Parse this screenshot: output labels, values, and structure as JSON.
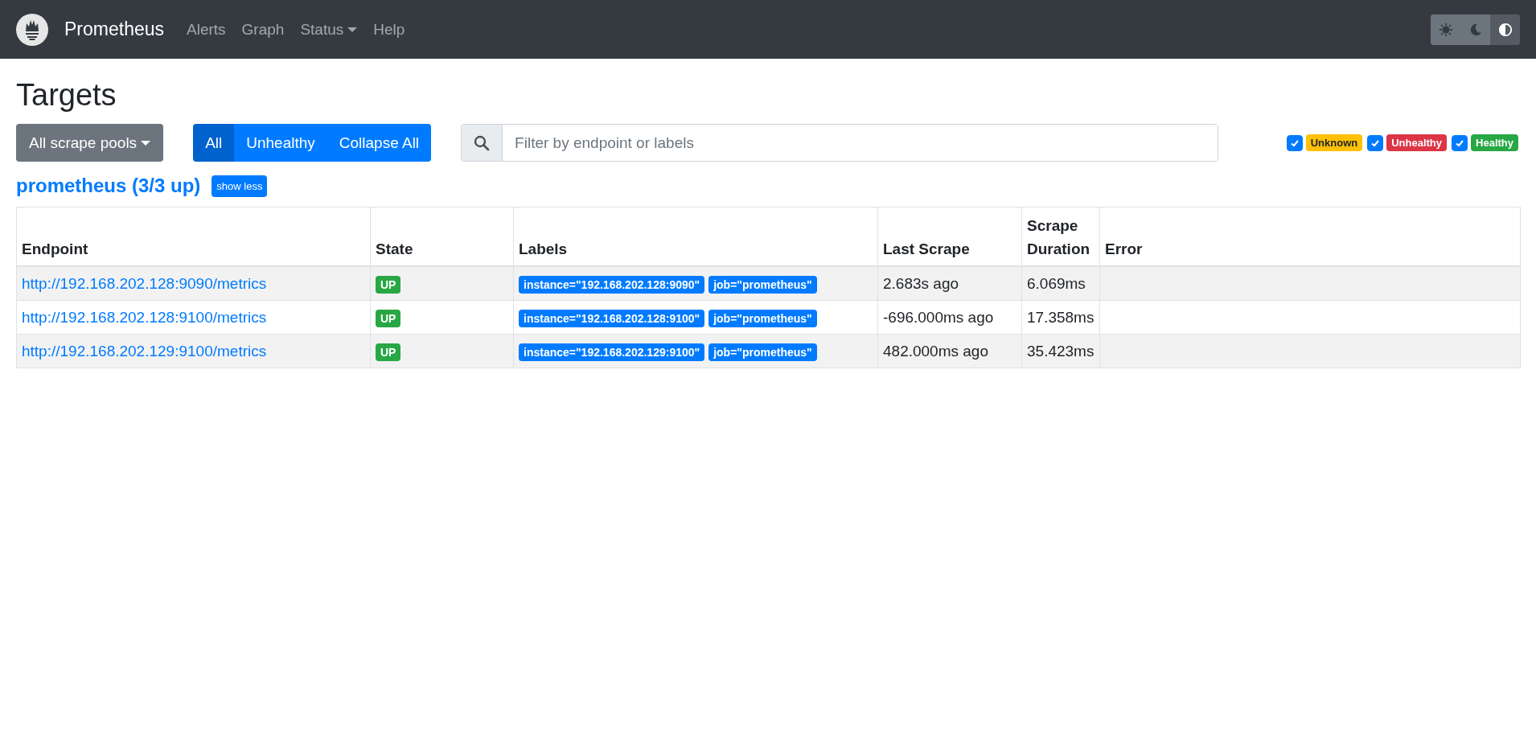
{
  "navbar": {
    "brand": "Prometheus",
    "links": [
      {
        "label": "Alerts",
        "kind": "link"
      },
      {
        "label": "Graph",
        "kind": "link"
      },
      {
        "label": "Status",
        "kind": "dropdown"
      },
      {
        "label": "Help",
        "kind": "link"
      }
    ],
    "theme_toggle": [
      {
        "kind": "light",
        "selected": false
      },
      {
        "kind": "dark",
        "selected": false
      },
      {
        "kind": "auto",
        "selected": true
      }
    ]
  },
  "page_title": "Targets",
  "pool_dropdown": "All scrape pools",
  "view_buttons": [
    {
      "label": "All",
      "selected": true
    },
    {
      "label": "Unhealthy",
      "selected": false
    },
    {
      "label": "Collapse All",
      "selected": false
    }
  ],
  "search": {
    "placeholder": "Filter by endpoint or labels"
  },
  "health_filters": [
    {
      "label": "Unknown",
      "checked": true,
      "color": "#ffc107"
    },
    {
      "label": "Unhealthy",
      "checked": true,
      "color": "#dc3545"
    },
    {
      "label": "Healthy",
      "checked": true,
      "color": "#28a745"
    }
  ],
  "pool": {
    "title": "prometheus (3/3 up)",
    "toggle": "show less",
    "table": {
      "columns": [
        "Endpoint",
        "State",
        "Labels",
        "Last Scrape",
        "Scrape Duration",
        "Error"
      ],
      "rows": [
        {
          "endpoint": "http://192.168.202.128:9090/metrics",
          "state": "UP",
          "color": "#28a745",
          "labels": [
            "instance=\"192.168.202.128:9090\"",
            "job=\"prometheus\""
          ],
          "last_scrape": "2.683s ago",
          "duration": "6.069ms"
        },
        {
          "endpoint": "http://192.168.202.128:9100/metrics",
          "state": "UP",
          "color": "#28a745",
          "labels": [
            "instance=\"192.168.202.128:9100\"",
            "job=\"prometheus\""
          ],
          "last_scrape": "-696.000ms ago",
          "duration": "17.358ms"
        },
        {
          "endpoint": "http://192.168.202.129:9100/metrics",
          "state": "UP",
          "color": "#28a745",
          "labels": [
            "instance=\"192.168.202.129:9100\"",
            "job=\"prometheus\""
          ],
          "last_scrape": "482.000ms ago",
          "duration": "35.423ms"
        }
      ]
    }
  }
}
